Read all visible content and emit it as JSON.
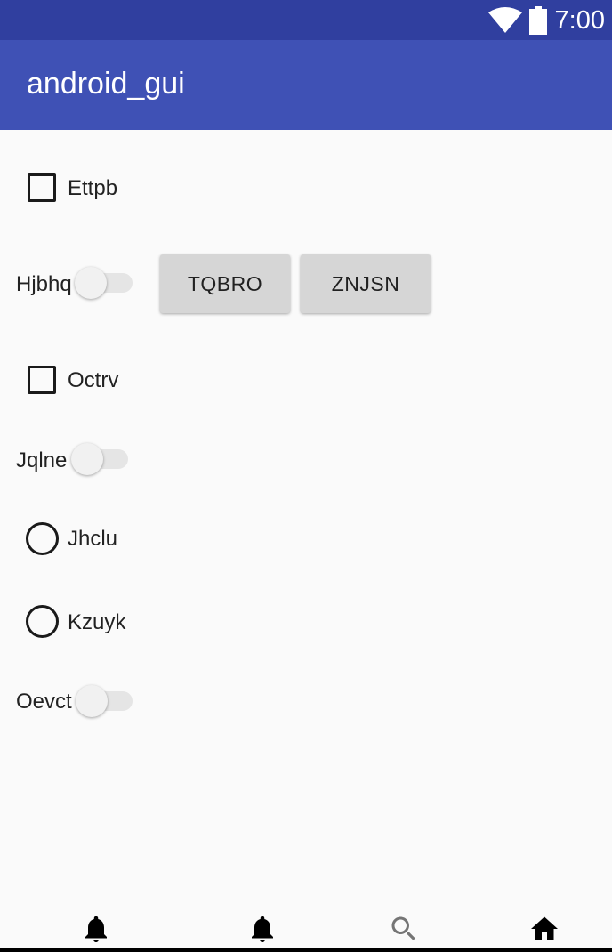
{
  "status_bar": {
    "time": "7:00"
  },
  "app_bar": {
    "title": "android_gui"
  },
  "controls": {
    "checkbox1": {
      "label": "Ettpb",
      "checked": false
    },
    "switch1": {
      "label": "Hjbhq",
      "on": false
    },
    "button1": {
      "label": "TQBRO"
    },
    "button2": {
      "label": "ZNJSN"
    },
    "checkbox2": {
      "label": "Octrv",
      "checked": false
    },
    "switch2": {
      "label": "Jqlne",
      "on": false
    },
    "radio1": {
      "label": "Jhclu",
      "selected": false
    },
    "radio2": {
      "label": "Kzuyk",
      "selected": false
    },
    "switch3": {
      "label": "Oevct",
      "on": false
    }
  },
  "bottom_nav": {
    "items": [
      {
        "icon": "bell-icon"
      },
      {
        "icon": "bell-icon"
      },
      {
        "icon": "search-icon"
      },
      {
        "icon": "home-icon"
      }
    ]
  },
  "colors": {
    "status_bar": "#303f9f",
    "app_bar": "#3f51b5",
    "background": "#fafafa",
    "button": "#d6d6d6"
  }
}
